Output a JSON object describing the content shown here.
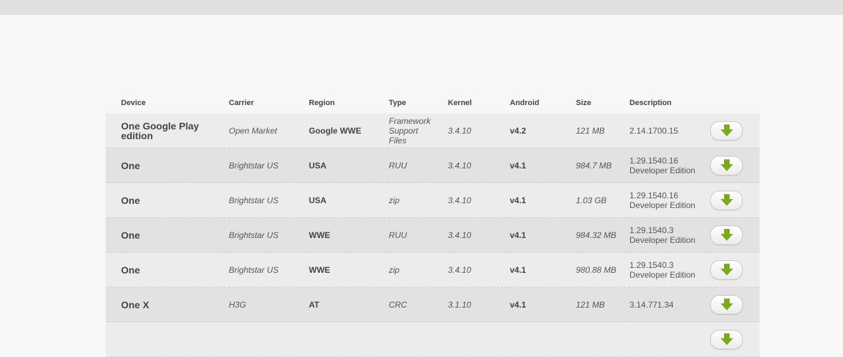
{
  "colors": {
    "accent": "#7aaa1e",
    "row_odd": "#ececec",
    "row_even": "#e2e2e2",
    "background": "#f7f7f7"
  },
  "table": {
    "headers": {
      "device": "Device",
      "carrier": "Carrier",
      "region": "Region",
      "type": "Type",
      "kernel": "Kernel",
      "android": "Android",
      "size": "Size",
      "description": "Description"
    },
    "rows": [
      {
        "device": "One Google Play edition",
        "carrier": "Open Market",
        "region": "Google WWE",
        "type": "Framework Support Files",
        "kernel": "3.4.10",
        "android": "v4.2",
        "size": "121 MB",
        "description": "2.14.1700.15",
        "button_icon": "download-arrow-icon"
      },
      {
        "device": "One",
        "carrier": "Brightstar US",
        "region": "USA",
        "type": "RUU",
        "kernel": "3.4.10",
        "android": "v4.1",
        "size": "984.7 MB",
        "description": "1.29.1540.16 Developer Edition",
        "button_icon": "download-arrow-icon"
      },
      {
        "device": "One",
        "carrier": "Brightstar US",
        "region": "USA",
        "type": "zip",
        "kernel": "3.4.10",
        "android": "v4.1",
        "size": "1.03 GB",
        "description": "1.29.1540.16 Developer Edition",
        "button_icon": "download-arrow-icon"
      },
      {
        "device": "One",
        "carrier": "Brightstar US",
        "region": "WWE",
        "type": "RUU",
        "kernel": "3.4.10",
        "android": "v4.1",
        "size": "984.32 MB",
        "description": "1.29.1540.3 Developer Edition",
        "button_icon": "download-arrow-icon"
      },
      {
        "device": "One",
        "carrier": "Brightstar US",
        "region": "WWE",
        "type": "zip",
        "kernel": "3.4.10",
        "android": "v4.1",
        "size": "980.88 MB",
        "description": "1.29.1540.3 Developer Edition",
        "button_icon": "download-arrow-icon"
      },
      {
        "device": "One X",
        "carrier": "H3G",
        "region": "AT",
        "type": "CRC",
        "kernel": "3.1.10",
        "android": "v4.1",
        "size": "121 MB",
        "description": "3.14.771.34",
        "button_icon": "download-arrow-icon"
      },
      {
        "device": "",
        "carrier": "",
        "region": "",
        "type": "",
        "kernel": "",
        "android": "",
        "size": "",
        "description": "",
        "button_icon": "download-arrow-icon"
      }
    ]
  }
}
